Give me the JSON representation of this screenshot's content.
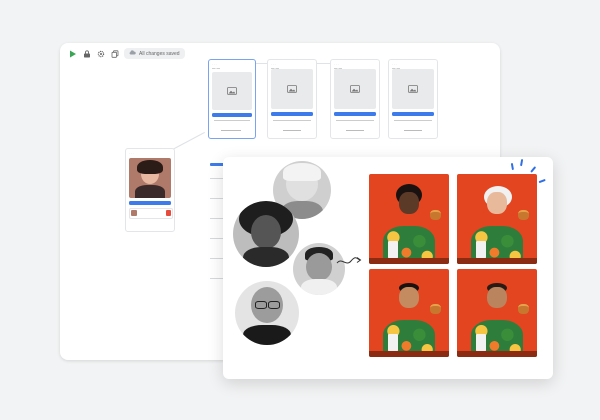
{
  "toolbar": {
    "status": "All changes saved",
    "icons": [
      "play-icon",
      "lock-icon",
      "gear-icon",
      "copy-icon",
      "cloud-icon"
    ]
  },
  "colors": {
    "accent": "#3d7bea",
    "background": "#ffffff",
    "canvas": "#f2f3f4",
    "tile_background": "#e2451f",
    "sparkle": "#2f6fe6"
  }
}
